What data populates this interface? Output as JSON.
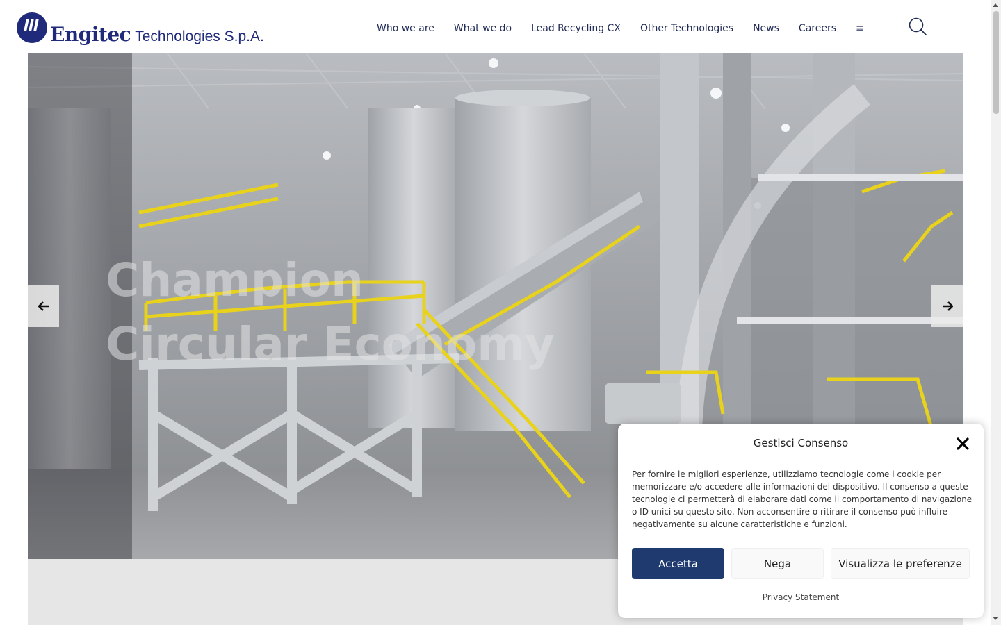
{
  "header": {
    "logo": {
      "brand": "Engitec",
      "rest": "Technologies S.p.A."
    },
    "nav": [
      {
        "label": "Who we are"
      },
      {
        "label": "What we do"
      },
      {
        "label": "Lead Recycling CX"
      },
      {
        "label": "Other Technologies"
      },
      {
        "label": "News"
      },
      {
        "label": "Careers"
      }
    ],
    "menu_glyph": "≡",
    "search_icon": "search-icon"
  },
  "hero": {
    "title_line1": "Champion",
    "title_line2": "Circular Economy",
    "prev_glyph": "🡐",
    "next_glyph": "🡒"
  },
  "consent": {
    "title": "Gestisci Consenso",
    "text": "Per fornire le migliori esperienze, utilizziamo tecnologie come i cookie per memorizzare e/o accedere alle informazioni del dispositivo. Il consenso a queste tecnologie ci permetterà di elaborare dati come il comportamento di navigazione o ID unici su questo sito. Non acconsentire o ritirare il consenso può influire negativamente su alcune caratteristiche e funzioni.",
    "accept": "Accetta",
    "deny": "Nega",
    "preferences": "Visualizza le preferenze",
    "privacy": "Privacy Statement"
  },
  "colors": {
    "brand_navy": "#1f2a7a",
    "accept_button": "#1e3a6e",
    "railing_yellow": "#e8d21c"
  }
}
